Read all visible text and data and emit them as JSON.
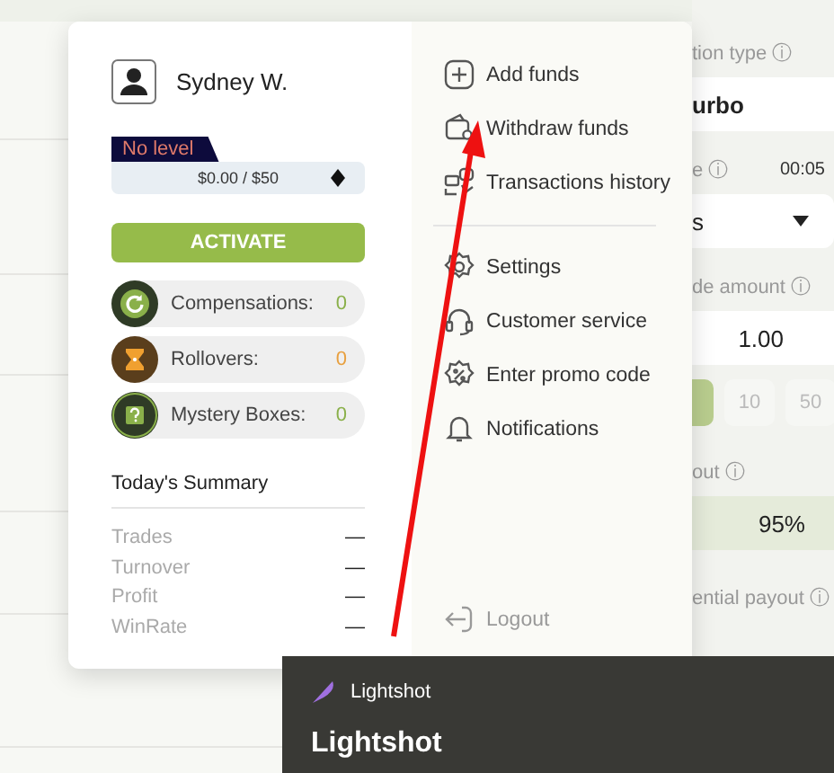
{
  "sidebar": {
    "trade_type_label": "tion type ⓘ",
    "trade_type": "urbo",
    "time_label": "e ⓘ",
    "time_value": "00:05",
    "time_select": "s",
    "amount_label": "de amount ⓘ",
    "amount": "1.00",
    "amount_presets": [
      "10",
      "50"
    ],
    "payout_label": "out ⓘ",
    "payout": "95%",
    "potential_label": "ential payout ⓘ"
  },
  "account_menu": {
    "user": {
      "name": "Sydney W."
    },
    "level": {
      "label": "No level",
      "progress_text": "$0.00 / $50",
      "level": 0
    },
    "activate_button": "ACTIVATE",
    "bonuses": [
      {
        "kind": "compensation",
        "label": "Compensations:",
        "value": "0",
        "color": "#8ab04a"
      },
      {
        "kind": "rollover",
        "label": "Rollovers:",
        "value": "0",
        "color": "#e8a040"
      },
      {
        "kind": "mystery",
        "label": "Mystery Boxes:",
        "value": "0",
        "color": "#8ab04a"
      }
    ],
    "summary": {
      "title": "Today's Summary",
      "rows": [
        {
          "label": "Trades",
          "value": "—"
        },
        {
          "label": "Turnover",
          "value": "—"
        },
        {
          "label": "Profit",
          "value": "—"
        },
        {
          "label": "WinRate",
          "value": "—"
        }
      ]
    },
    "menu_groups": [
      [
        {
          "kind": "add",
          "label": "Add funds"
        },
        {
          "kind": "withdraw",
          "label": "Withdraw funds"
        },
        {
          "kind": "history",
          "label": "Transactions history"
        }
      ],
      [
        {
          "kind": "settings",
          "label": "Settings"
        },
        {
          "kind": "support",
          "label": "Customer service"
        },
        {
          "kind": "promo",
          "label": "Enter promo code"
        },
        {
          "kind": "bell",
          "label": "Notifications"
        }
      ]
    ],
    "logout": "Logout"
  },
  "lightshot": {
    "app_name": "Lightshot",
    "title": "Lightshot"
  }
}
